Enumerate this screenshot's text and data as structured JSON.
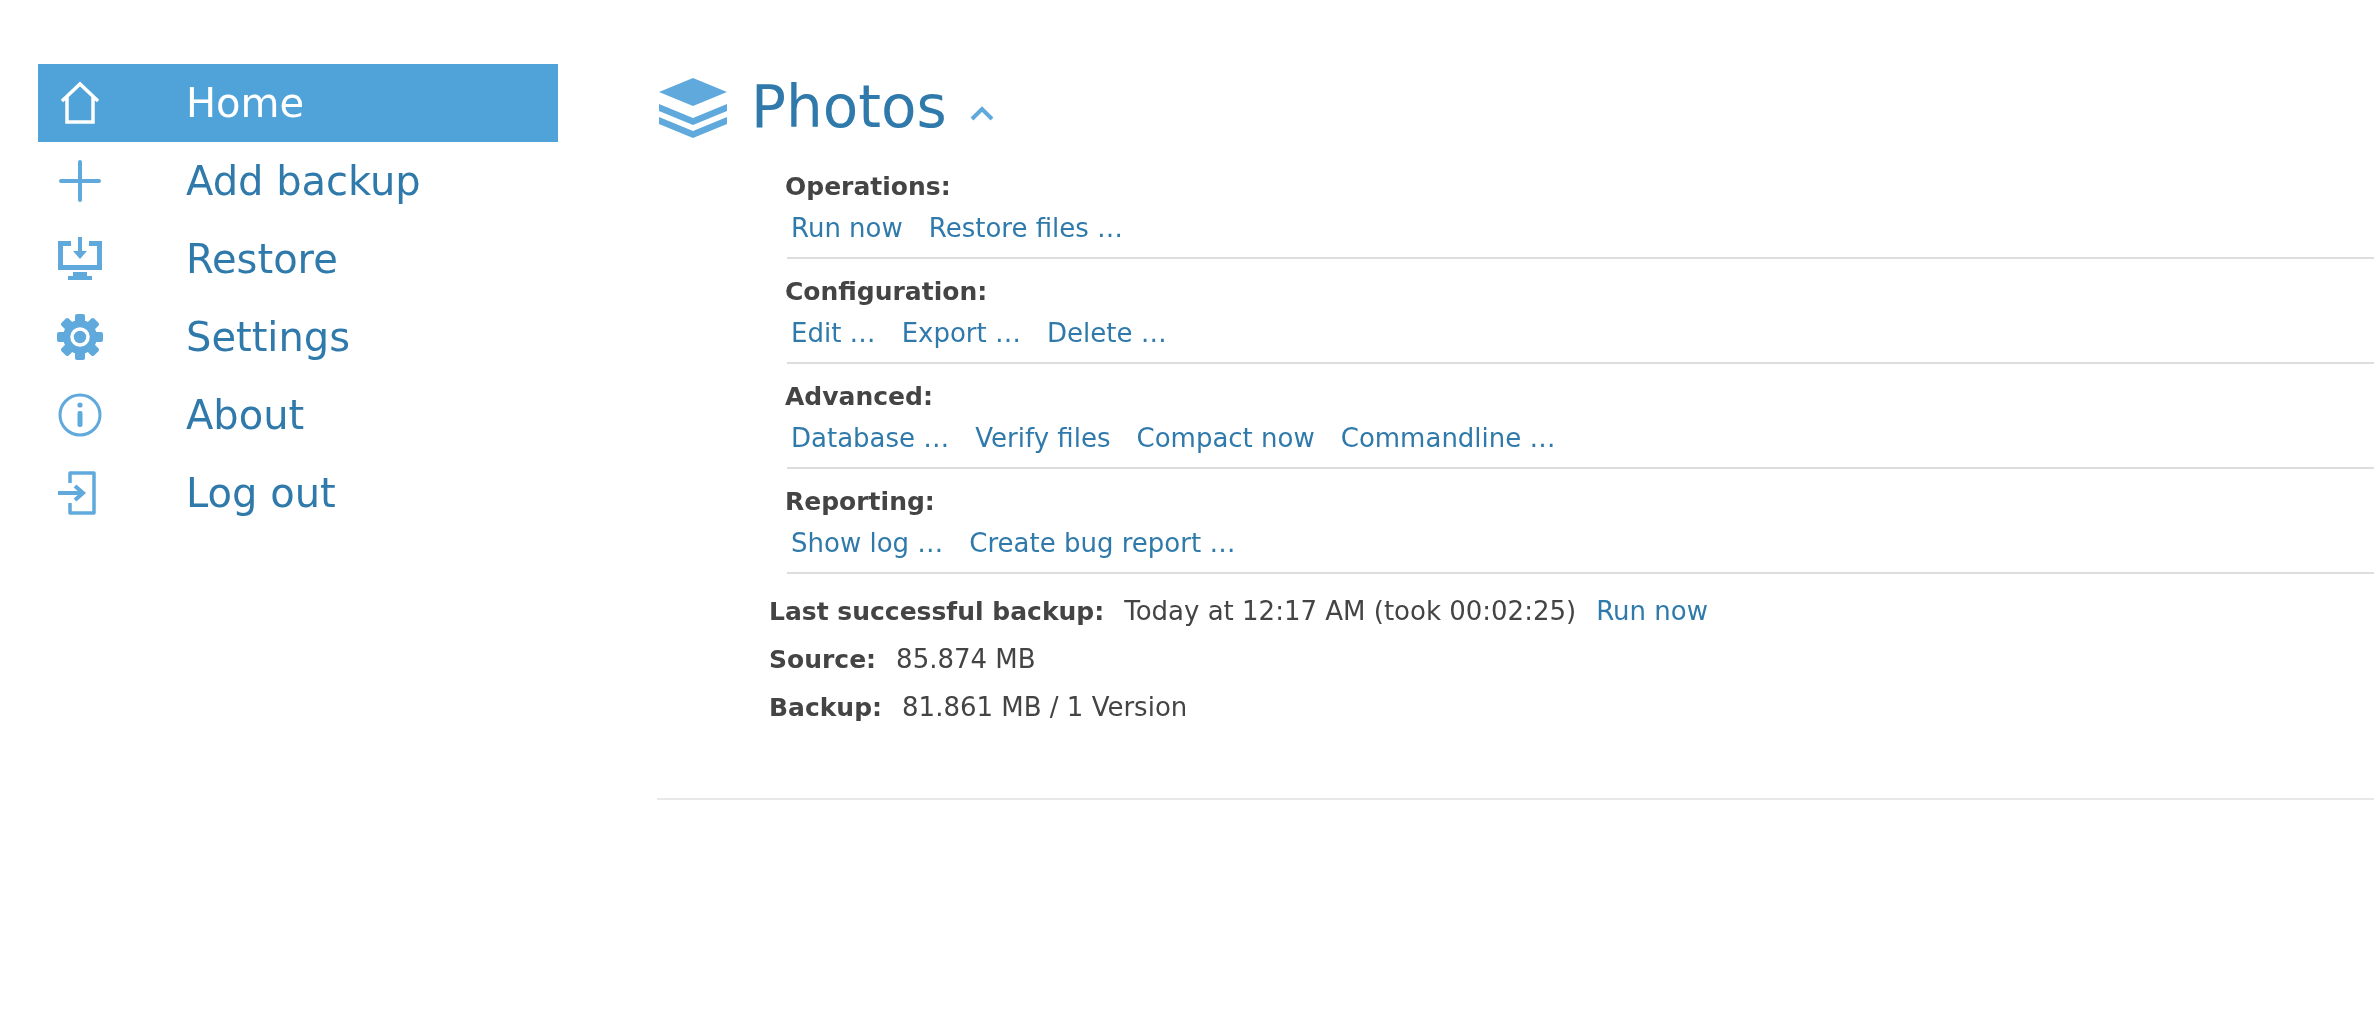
{
  "sidebar": {
    "items": [
      {
        "kind": "home",
        "label": "Home",
        "selected": true
      },
      {
        "kind": "add",
        "label": "Add backup",
        "selected": false
      },
      {
        "kind": "restore",
        "label": "Restore",
        "selected": false
      },
      {
        "kind": "settings",
        "label": "Settings",
        "selected": false
      },
      {
        "kind": "about",
        "label": "About",
        "selected": false
      },
      {
        "kind": "logout",
        "label": "Log out",
        "selected": false
      }
    ]
  },
  "backup": {
    "title": "Photos",
    "expanded": true,
    "sections": [
      {
        "title": "Operations:",
        "links": [
          "Run now",
          "Restore files …"
        ]
      },
      {
        "title": "Configuration:",
        "links": [
          "Edit …",
          "Export …",
          "Delete …"
        ]
      },
      {
        "title": "Advanced:",
        "links": [
          "Database …",
          "Verify files",
          "Compact now",
          "Commandline …"
        ]
      },
      {
        "title": "Reporting:",
        "links": [
          "Show log …",
          "Create bug report …"
        ]
      }
    ],
    "stats": [
      {
        "label": "Last successful backup:",
        "value": "Today at 12:17 AM (took 00:02:25)",
        "link": "Run now"
      },
      {
        "label": "Source:",
        "value": "85.874 MB"
      },
      {
        "label": "Backup:",
        "value": "81.861 MB / 1 Version"
      }
    ]
  }
}
